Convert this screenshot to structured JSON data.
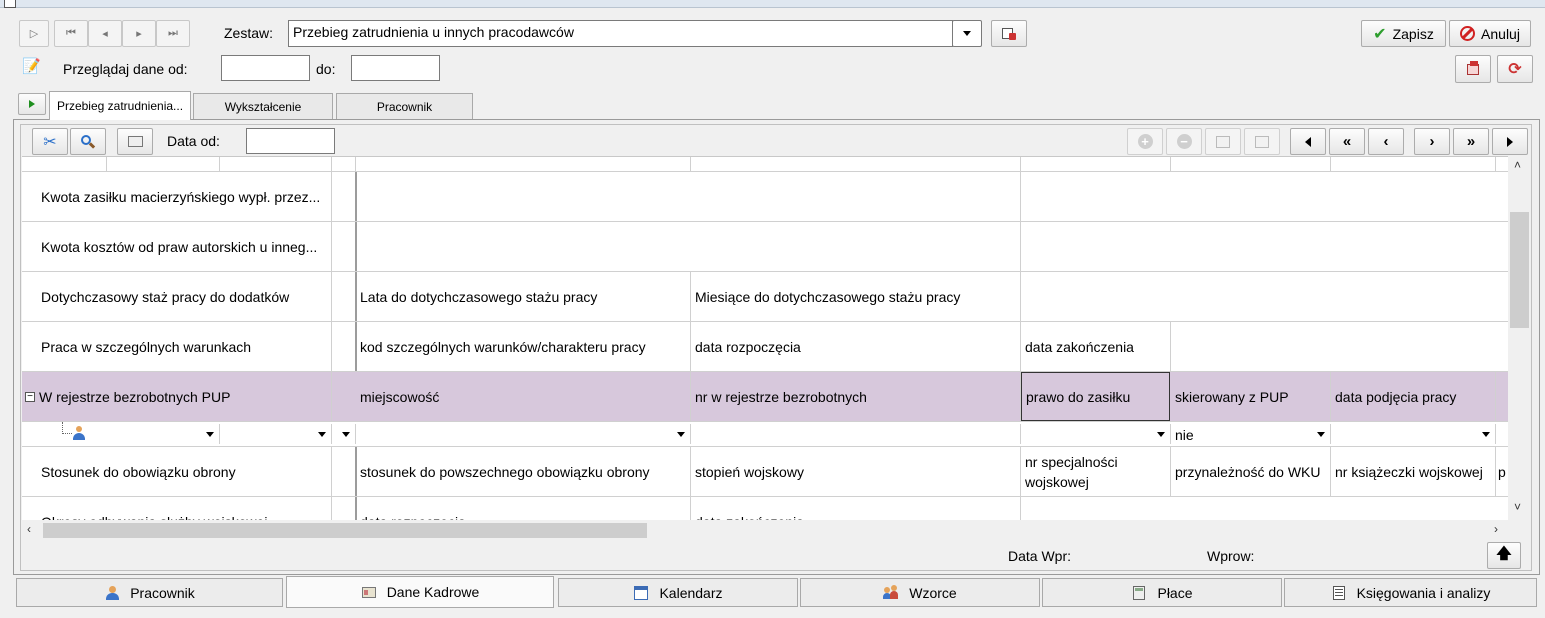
{
  "toolbar": {
    "zestaw_label": "Zestaw:",
    "zestaw_value": "Przebieg zatrudnienia u innych pracodawców",
    "save_label": "Zapisz",
    "cancel_label": "Anuluj",
    "browse_label": "Przeglądaj dane od:",
    "to_label": "do:",
    "date_from_value": "",
    "date_to_value": ""
  },
  "tabs": [
    {
      "label": "Przebieg zatrudnienia..."
    },
    {
      "label": "Wykształcenie"
    },
    {
      "label": "Pracownik"
    }
  ],
  "subtoolbar": {
    "data_od_label": "Data od:",
    "data_od_value": ""
  },
  "grid": {
    "rows": [
      {
        "label": "Kwota zasiłku macierzyńskiego wypł. przez...",
        "cells": []
      },
      {
        "label": "Kwota kosztów od praw autorskich u inneg...",
        "cells": []
      },
      {
        "label": "Dotychczasowy staż pracy do dodatków",
        "cells": [
          "Lata do dotychczasowego stażu pracy",
          "Miesiące do dotychczasowego stażu pracy"
        ]
      },
      {
        "label": "Praca w szczególnych warunkach",
        "cells": [
          "kod szczególnych warunków/charakteru pracy",
          "data rozpoczęcia",
          "data zakończenia"
        ]
      },
      {
        "label": "W rejestrze bezrobotnych PUP",
        "cells": [
          "miejscowość",
          "nr w rejestrze bezrobotnych",
          "prawo do zasiłku",
          "skierowany z PUP",
          "data podjęcia pracy"
        ]
      },
      {
        "label": "Stosunek do obowiązku obrony",
        "cells": [
          "stosunek do powszechnego obowiązku obrony",
          "stopień wojskowy",
          "nr specjalności wojskowej",
          "przynależność do WKU",
          "nr książeczki wojskowej",
          "p"
        ]
      },
      {
        "label": "Okresy odbywania służby wojskowej",
        "cells": [
          "data rozpoczęcia",
          "data zakończenia"
        ]
      }
    ],
    "edit_row": {
      "skierowany_value": "nie"
    }
  },
  "footer": {
    "data_wpr_label": "Data Wpr:",
    "wprow_label": "Wprow:"
  },
  "bottom_tabs": [
    {
      "label": "Pracownik",
      "icon": "person-icon"
    },
    {
      "label": "Dane Kadrowe",
      "icon": "id-card-icon"
    },
    {
      "label": "Kalendarz",
      "icon": "calendar-icon"
    },
    {
      "label": "Wzorce",
      "icon": "people-icon"
    },
    {
      "label": "Płace",
      "icon": "calculator-icon"
    },
    {
      "label": "Księgowania i analizy",
      "icon": "ledger-icon"
    }
  ],
  "colors": {
    "highlight_row": "#d7c8dc",
    "save_check": "#2e9e2e",
    "cancel_red": "#d02020"
  }
}
